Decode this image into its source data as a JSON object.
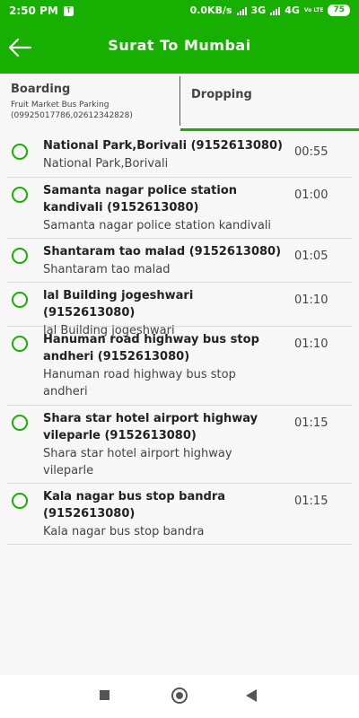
{
  "status": {
    "time": "2:50 PM",
    "speed": "0.0KB/s",
    "net1": "3G",
    "net2": "4G",
    "volte": "Vo LTE",
    "battery": "75"
  },
  "header": {
    "title": "Surat To Mumbai",
    "accent": "#18b000"
  },
  "tabs": {
    "boarding": {
      "label": "Boarding",
      "sub1": "Fruit Market Bus Parking",
      "sub2": "(09925017786,02612342828)"
    },
    "dropping": {
      "label": "Dropping"
    }
  },
  "stops": [
    {
      "name": "National Park,Borivali (9152613080)",
      "address": "National Park,Borivali",
      "time": "00:55"
    },
    {
      "name": "Samanta nagar police station kandivali (9152613080)",
      "address": "Samanta nagar police station kandivali",
      "time": "01:00"
    },
    {
      "name": "Shantaram tao malad (9152613080)",
      "address": "Shantaram tao malad",
      "time": "01:05"
    },
    {
      "name": "lal Building jogeshwari (9152613080)",
      "address": "lal Building jogeshwari",
      "time": "01:10"
    },
    {
      "name": "Hanuman road highway bus stop andheri (9152613080)",
      "address": "Hanuman road highway bus stop andheri",
      "time": "01:10"
    },
    {
      "name": "Shara star hotel airport highway vileparle (9152613080)",
      "address": "Shara star hotel airport highway vileparle",
      "time": "01:15"
    },
    {
      "name": "Kala nagar bus stop bandra (9152613080)",
      "address": "Kala nagar bus stop bandra",
      "time": "01:15"
    }
  ]
}
